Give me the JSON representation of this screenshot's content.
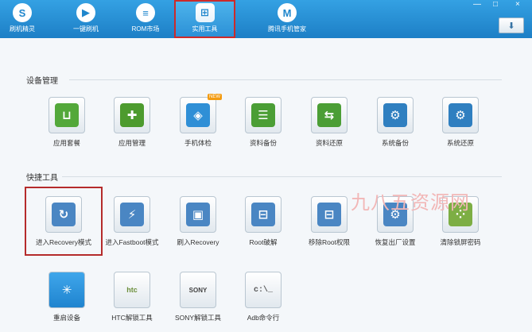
{
  "nav": {
    "items": [
      {
        "label": "刷机精灵",
        "icon": "S"
      },
      {
        "label": "一键刷机",
        "icon": "▶"
      },
      {
        "label": "ROM市场",
        "icon": "≡"
      },
      {
        "label": "实用工具",
        "icon": "⊞"
      },
      {
        "label": "腾讯手机管家",
        "icon": "M"
      }
    ]
  },
  "window": {
    "min": "—",
    "close": "×",
    "refresh": "⬇"
  },
  "sections": {
    "device": "设备管理",
    "quick": "快捷工具"
  },
  "device_tools": [
    {
      "label": "应用套餐",
      "glyph": "⊔",
      "color": "#53a83a"
    },
    {
      "label": "应用管理",
      "glyph": "✚",
      "color": "#4d9b2e"
    },
    {
      "label": "手机体检",
      "glyph": "◈",
      "color": "#2f8fd6"
    },
    {
      "label": "资料备份",
      "glyph": "☰",
      "color": "#4b9e35"
    },
    {
      "label": "资料还原",
      "glyph": "⇆",
      "color": "#4b9e35"
    },
    {
      "label": "系统备份",
      "glyph": "⚙",
      "color": "#2f7fc0"
    },
    {
      "label": "系统还原",
      "glyph": "⚙",
      "color": "#2f7fc0"
    }
  ],
  "badge_new": "NEW",
  "quick_tools_row1": [
    {
      "label": "进入Recovery模式",
      "glyph": "↻",
      "color": "#4a86c3"
    },
    {
      "label": "进入Fastboot模式",
      "glyph": "⚡",
      "color": "#4a86c3"
    },
    {
      "label": "刷入Recovery",
      "glyph": "▣",
      "color": "#4a86c3"
    },
    {
      "label": "Root破解",
      "glyph": "⊟",
      "color": "#4a86c3"
    },
    {
      "label": "移除Root权限",
      "glyph": "⊟",
      "color": "#4a86c3"
    },
    {
      "label": "恢复出厂设置",
      "glyph": "⚙",
      "color": "#4a86c3"
    },
    {
      "label": "清除锁屏密码",
      "glyph": "⁘",
      "color": "#7dae44"
    }
  ],
  "quick_tools_row2": [
    {
      "label": "重启设备",
      "glyph": "✳",
      "color": "#2f8fd6"
    },
    {
      "label": "HTC解锁工具",
      "glyph": "htc",
      "color": "#6b8e3a"
    },
    {
      "label": "SONY解锁工具",
      "glyph": "SONY",
      "color": "#444"
    },
    {
      "label": "Adb命令行",
      "glyph": "c:\\_",
      "color": "#555"
    }
  ],
  "watermark": "九八五资源网",
  "colors": {
    "topbar": "#2a8fd6",
    "highlight": "#b52b2b"
  }
}
